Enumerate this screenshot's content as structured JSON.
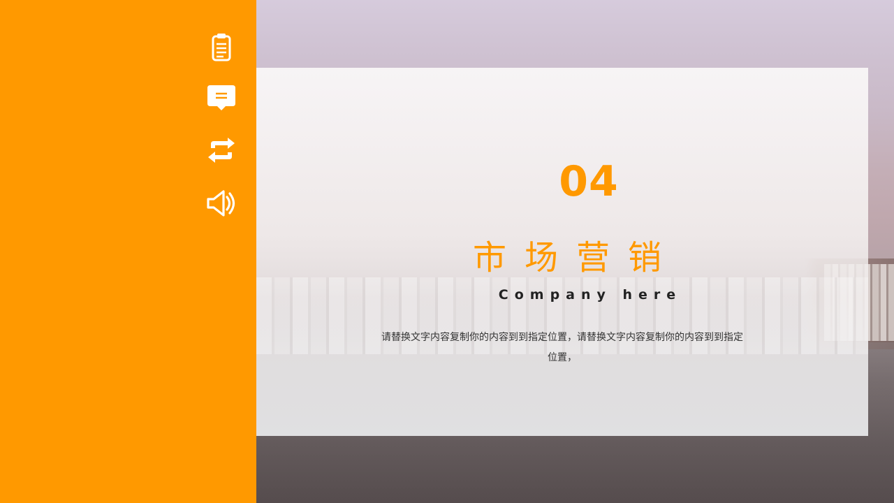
{
  "sidebar": {
    "color": "#ff9900",
    "icons": [
      "clipboard-icon",
      "message-icon",
      "repeat-icon",
      "speaker-icon"
    ]
  },
  "main": {
    "number": "04",
    "title": "市场营销",
    "subtitle": "Company here",
    "body": "请替换文字内容复制你的内容到到指定位置，请替换文字内容复制你的内容到到指定位置，"
  },
  "colors": {
    "accent": "#ff9900",
    "text_dark": "#222222"
  }
}
